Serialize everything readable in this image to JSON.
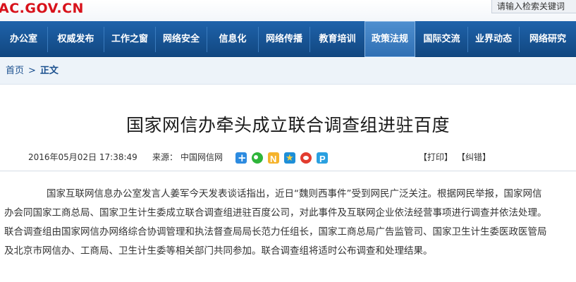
{
  "header": {
    "logo": "AC.GOV.CN",
    "search_placeholder": "请输入检索关键词"
  },
  "nav": {
    "items": [
      {
        "label": "办公室"
      },
      {
        "label": "权威发布"
      },
      {
        "label": "工作之窗"
      },
      {
        "label": "网络安全"
      },
      {
        "label": "信息化"
      },
      {
        "label": "网络传播"
      },
      {
        "label": "教育培训"
      },
      {
        "label": "政策法规",
        "active": true
      },
      {
        "label": "国际交流"
      },
      {
        "label": "业界动态"
      },
      {
        "label": "网络研究"
      }
    ]
  },
  "breadcrumb": {
    "home": "首页",
    "separator": ">",
    "current": "正文"
  },
  "article": {
    "title": "国家网信办牵头成立联合调查组进驻百度",
    "date": "2016年05月02日 17:38:49",
    "source_label": "来源：",
    "source": "中国网信网",
    "share_icons": [
      "plus-icon",
      "wechat-icon",
      "n-icon",
      "star-icon",
      "weibo-icon",
      "p-icon"
    ],
    "print": "【打印】",
    "correct": "【纠错】",
    "lines": [
      "国家互联网信息办公室发言人姜军今天发表谈话指出，近日“魏则西事件”受到网民广泛关注。根据网民举报，国家网信",
      "办会同国家工商总局、国家卫生计生委成立联合调查组进驻百度公司，对此事件及互联网企业依法经营事项进行调查并依法处理。",
      "联合调查组由国家网信办网络综合协调管理和执法督查局局长范力任组长，国家工商总局广告监管司、国家卫生计生委医政医管局",
      "及北京市网信办、工商局、卫生计生委等相关部门共同参加。联合调查组将适时公布调查和处理结果。"
    ]
  },
  "colors": {
    "nav_bg": "#1a5799",
    "nav_active": "#3b7cc2",
    "logo_red": "#d8121b",
    "link_blue": "#1a4f8e"
  }
}
